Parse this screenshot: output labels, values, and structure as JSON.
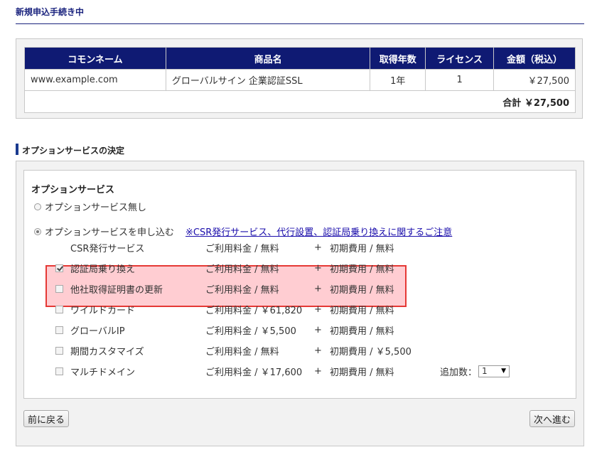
{
  "page_title": "新規申込手続き中",
  "order_table": {
    "headers": [
      "コモンネーム",
      "商品名",
      "取得年数",
      "ライセンス",
      "金額（税込）"
    ],
    "rows": [
      {
        "common_name": "www.example.com",
        "product": "グローバルサイン 企業認証SSL",
        "years": "1年",
        "license": "1",
        "amount": "￥27,500"
      }
    ],
    "total": "合計 ￥27,500"
  },
  "section_heading": "オプションサービスの決定",
  "options": {
    "title": "オプションサービス",
    "radio_none": "オプションサービス無し",
    "radio_apply": "オプションサービスを申し込む",
    "notice_link": "※CSR発行サービス、代行設置、認証局乗り換えに関するご注意",
    "services": [
      {
        "name": "CSR発行サービス",
        "fee": "ご利用料金 / 無料",
        "plus": "+",
        "initial": "初期費用 / 無料",
        "checkbox": false,
        "checked": false
      },
      {
        "name": "認証局乗り換え",
        "fee": "ご利用料金 / 無料",
        "plus": "+",
        "initial": "初期費用 / 無料",
        "checkbox": true,
        "checked": true
      },
      {
        "name": "他社取得証明書の更新",
        "fee": "ご利用料金 / 無料",
        "plus": "+",
        "initial": "初期費用 / 無料",
        "checkbox": true,
        "checked": false
      },
      {
        "name": "ワイルドカード",
        "fee": "ご利用料金 / ￥61,820",
        "plus": "+",
        "initial": "初期費用 / 無料",
        "checkbox": true,
        "checked": false
      },
      {
        "name": "グローバルIP",
        "fee": "ご利用料金 / ￥5,500",
        "plus": "+",
        "initial": "初期費用 / 無料",
        "checkbox": true,
        "checked": false
      },
      {
        "name": "期間カスタマイズ",
        "fee": "ご利用料金 / 無料",
        "plus": "+",
        "initial": "初期費用 / ￥5,500",
        "checkbox": true,
        "checked": false
      },
      {
        "name": "マルチドメイン",
        "fee": "ご利用料金 / ￥17,600",
        "plus": "+",
        "initial": "初期費用 / 無料",
        "checkbox": true,
        "checked": false
      }
    ],
    "additional_label": "追加数：",
    "additional_value": "1"
  },
  "buttons": {
    "back": "前に戻る",
    "next": "次へ進む"
  },
  "colors": {
    "header_bg": "#0f1a73",
    "highlight_bg": "#ffcdd2",
    "highlight_border": "#e53935"
  }
}
